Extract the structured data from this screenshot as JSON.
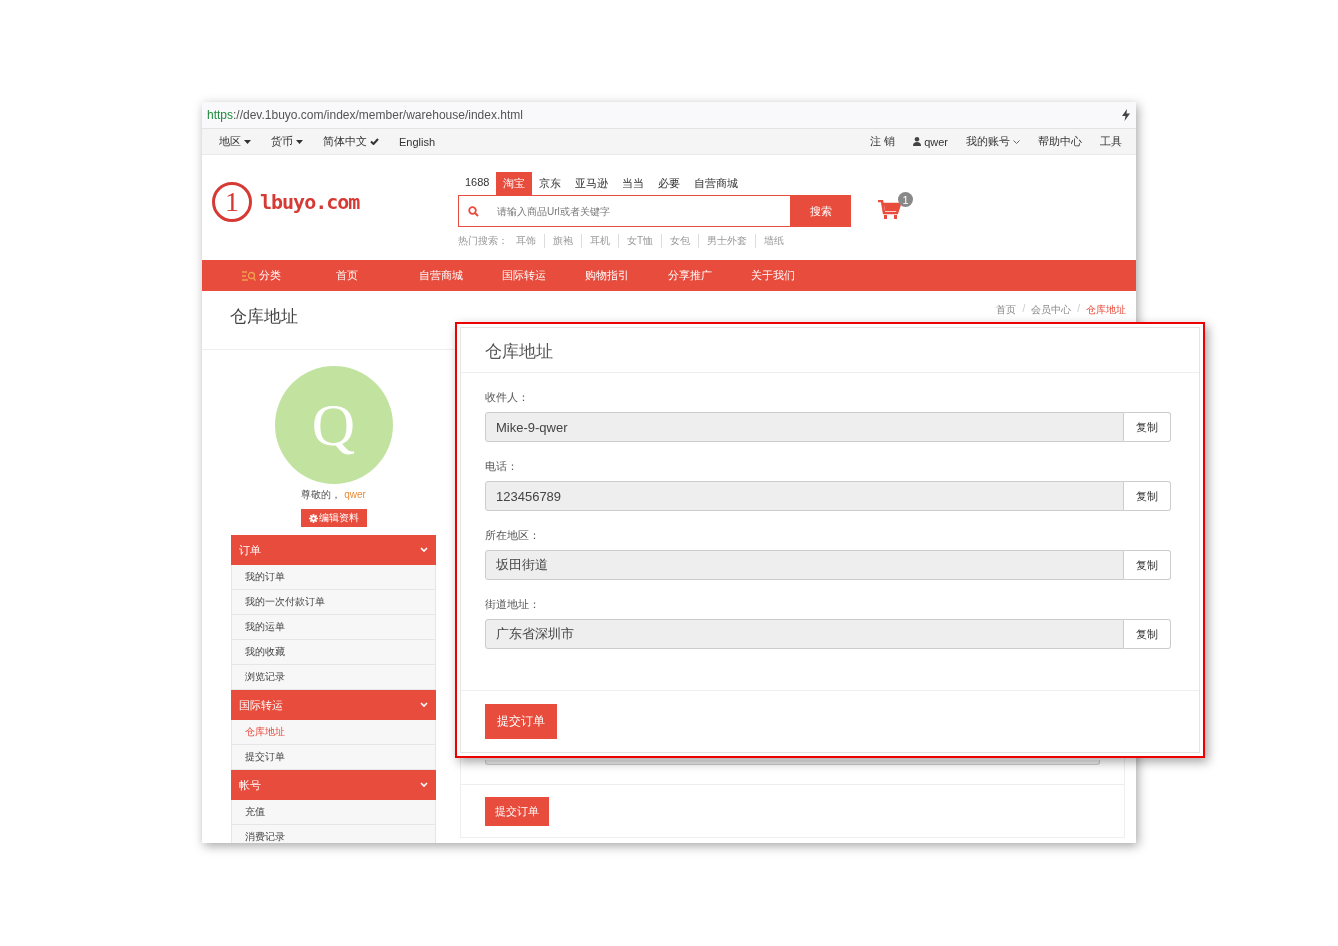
{
  "browser": {
    "url_scheme": "https",
    "url_rest": "://dev.1buyo.com/index/member/warehouse/index.html"
  },
  "top_bar": {
    "left": [
      {
        "label": "地区",
        "kind": "caret"
      },
      {
        "label": "货币",
        "kind": "caret"
      },
      {
        "label": "简体中文",
        "kind": "check"
      },
      {
        "label": "English",
        "kind": "plain"
      }
    ],
    "right": [
      {
        "label": "注 销",
        "kind": "plain"
      },
      {
        "label": "qwer",
        "kind": "user"
      },
      {
        "label": "我的账号",
        "kind": "chevron"
      },
      {
        "label": "帮助中心",
        "kind": "plain"
      },
      {
        "label": "工具",
        "kind": "plain"
      }
    ]
  },
  "logo": {
    "mark": "1",
    "text": "lbuyo.com"
  },
  "search": {
    "tabs": [
      {
        "label": "1688",
        "selected": false
      },
      {
        "label": "淘宝",
        "selected": true
      },
      {
        "label": "京东",
        "selected": false
      },
      {
        "label": "亚马逊",
        "selected": false
      },
      {
        "label": "当当",
        "selected": false
      },
      {
        "label": "必要",
        "selected": false
      },
      {
        "label": "自营商城",
        "selected": false
      }
    ],
    "placeholder": "请输入商品Url或者关键字",
    "button": "搜索",
    "hot_label": "热门搜索：",
    "hot": [
      "耳饰",
      "旗袍",
      "耳机",
      "女T恤",
      "女包",
      "男士外套",
      "墙纸"
    ]
  },
  "cart": {
    "count": "1"
  },
  "nav": [
    {
      "label": "分类",
      "kind": "category"
    },
    {
      "label": "首页",
      "kind": "link"
    },
    {
      "label": "自营商城",
      "kind": "link"
    },
    {
      "label": "国际转运",
      "kind": "link"
    },
    {
      "label": "购物指引",
      "kind": "link"
    },
    {
      "label": "分享推广",
      "kind": "link"
    },
    {
      "label": "关于我们",
      "kind": "link"
    }
  ],
  "page": {
    "title": "仓库地址",
    "separator": "/",
    "breadcrumb": [
      {
        "label": "首页",
        "selected": false
      },
      {
        "label": "会员中心",
        "selected": false
      },
      {
        "label": "仓库地址",
        "selected": true
      }
    ]
  },
  "profile": {
    "avatar_letter": "Q",
    "greeting": "尊敬的，",
    "username": "qwer",
    "edit_button": "编辑资料"
  },
  "menu": [
    {
      "label": "订单",
      "expanded": true,
      "children": [
        {
          "label": "我的订单",
          "selected": false
        },
        {
          "label": "我的一次付款订单",
          "selected": false
        },
        {
          "label": "我的运单",
          "selected": false
        },
        {
          "label": "我的收藏",
          "selected": false
        },
        {
          "label": "浏览记录",
          "selected": false
        }
      ]
    },
    {
      "label": "国际转运",
      "expanded": true,
      "children": [
        {
          "label": "仓库地址",
          "selected": true
        },
        {
          "label": "提交订单",
          "selected": false
        }
      ]
    },
    {
      "label": "帐号",
      "expanded": true,
      "children": [
        {
          "label": "充值",
          "selected": false
        },
        {
          "label": "消费记录",
          "selected": false
        }
      ]
    }
  ],
  "address_card": {
    "submit": "提交订单"
  },
  "callout": {
    "title": "仓库地址",
    "fields": [
      {
        "label": "收件人：",
        "value": "Mike-9-qwer",
        "copy": "复制"
      },
      {
        "label": "电话：",
        "value": "123456789",
        "copy": "复制"
      },
      {
        "label": "所在地区：",
        "value": "坂田街道",
        "copy": "复制"
      },
      {
        "label": "街道地址：",
        "value": "广东省深圳市",
        "copy": "复制"
      }
    ],
    "submit": "提交订单"
  }
}
